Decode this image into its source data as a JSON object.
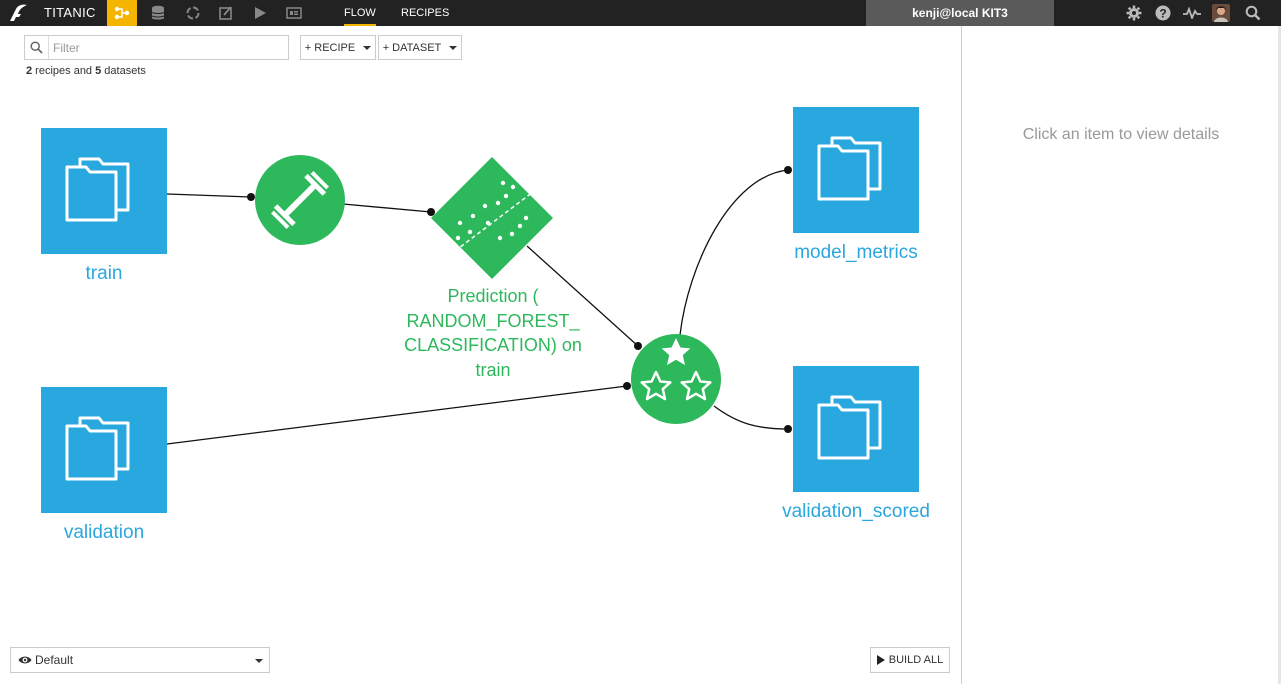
{
  "header": {
    "project_name": "TITANIC",
    "tabs": [
      {
        "label": "FLOW",
        "active": true
      },
      {
        "label": "RECIPES",
        "active": false
      }
    ],
    "user_label": "kenji@local KIT3",
    "nav_icons": [
      "flow-icon",
      "datasets-icon",
      "recipes-cycle-icon",
      "notebook-icon",
      "jobs-play-icon",
      "dashboard-icon"
    ],
    "right_icons": [
      "gear-icon",
      "help-icon",
      "activity-icon",
      "avatar",
      "search-icon"
    ],
    "accent_color": "#f5b400"
  },
  "toolbar": {
    "filter_placeholder": "Filter",
    "recipe_button_label": "+ RECIPE",
    "dataset_button_label": "+ DATASET",
    "summary": {
      "recipes_count": "2",
      "recipes_text": " recipes and ",
      "datasets_count": "5",
      "datasets_text": " datasets"
    }
  },
  "flow": {
    "datasets": [
      {
        "name": "train",
        "icon": "folder-icon"
      },
      {
        "name": "validation",
        "icon": "folder-icon"
      },
      {
        "name": "model_metrics",
        "icon": "folder-icon"
      },
      {
        "name": "validation_scored",
        "icon": "folder-icon"
      }
    ],
    "recipes": [
      {
        "name": "",
        "icon": "dumbbell-icon",
        "kind": "train"
      },
      {
        "name": "",
        "icon": "stars-icon",
        "kind": "score"
      }
    ],
    "model": {
      "name": "Prediction ( RANDOM_FOREST_ CLASSIFICATION) on train",
      "icon": "scatter-model-icon"
    },
    "dataset_color": "#29a8e0",
    "recipe_color": "#2eb85c"
  },
  "footer": {
    "view_select_value": "Default",
    "build_all_label": "BUILD ALL"
  },
  "details_panel": {
    "hint": "Click an item to view details"
  }
}
